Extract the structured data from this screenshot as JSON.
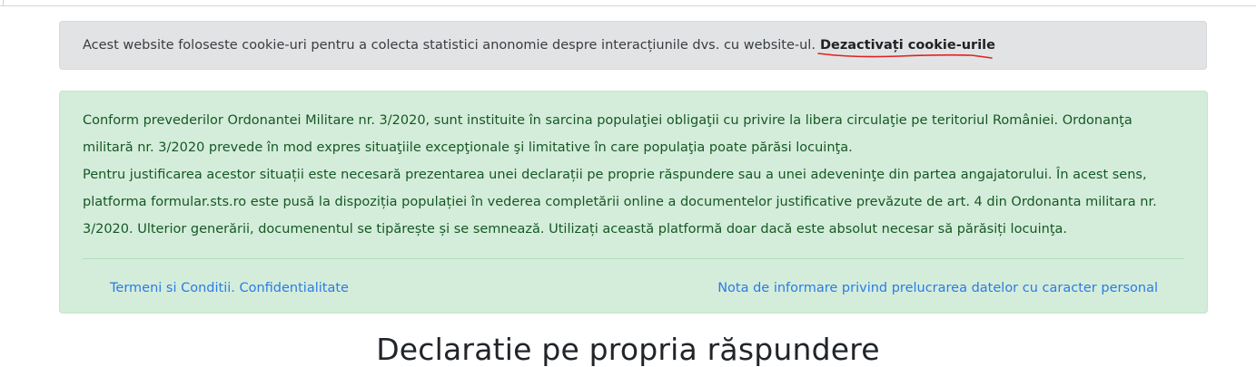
{
  "cookie_banner": {
    "text": "Acest website foloseste cookie-uri pentru a colecta statistici anonomie despre interacțiunile dvs. cu website-ul.",
    "disable_link": "Dezactivați cookie-urile",
    "annotation_color": "#e02020"
  },
  "info": {
    "paragraph_1": "Conform prevederilor Ordonantei Militare nr. 3/2020, sunt instituite în sarcina populaţiei obligaţii cu privire la libera circulaţie pe teritoriul României. Ordonanţa militară nr. 3/2020 prevede în mod expres situaţiile excepţionale şi limitative în care populaţia poate părăsi locuinţa.",
    "paragraph_2": "Pentru justificarea acestor situații este necesară prezentarea unei declarații pe proprie răspundere sau a unei adeveninţe din partea angajatorului. În acest sens, platforma formular.sts.ro este pusă la dispoziția populației în vederea completării online a documentelor justificative prevăzute de art. 4 din Ordonanta militara nr. 3/2020. Ulterior generării, documenentul se tipărește și se semnează. Utilizați această platformă doar dacă este absolut necesar să părăsiți locuinţa.",
    "link_terms": "Termeni si Conditii. Confidentialitate",
    "link_privacy": "Nota de informare privind prelucrarea datelor cu caracter personal"
  },
  "page_title": "Declaratie pe propria răspundere",
  "colors": {
    "cookie_bg": "#e2e3e5",
    "info_bg": "#d4edda",
    "info_text": "#155724",
    "link": "#2c7be5"
  }
}
